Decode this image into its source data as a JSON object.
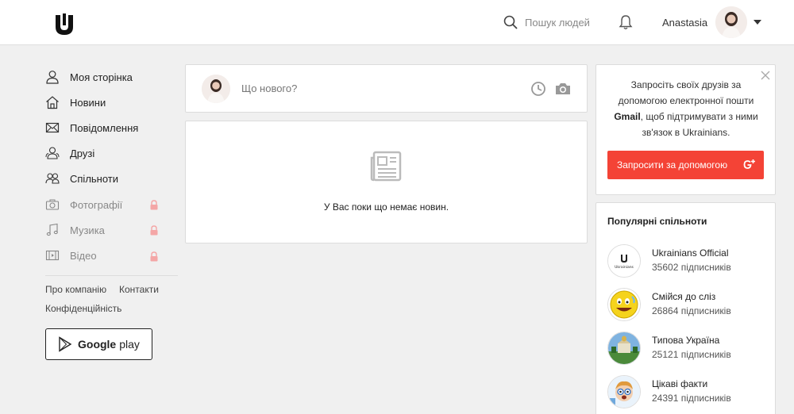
{
  "header": {
    "search_placeholder": "Пошук людей",
    "username": "Anastasia"
  },
  "sidebar": {
    "items": [
      {
        "label": "Моя сторінка",
        "icon": "user-icon",
        "locked": false
      },
      {
        "label": "Новини",
        "icon": "home-icon",
        "locked": false
      },
      {
        "label": "Повідомлення",
        "icon": "mail-icon",
        "locked": false
      },
      {
        "label": "Друзі",
        "icon": "friends-icon",
        "locked": false
      },
      {
        "label": "Спільноти",
        "icon": "communities-icon",
        "locked": false
      },
      {
        "label": "Фотографії",
        "icon": "camera-icon",
        "locked": true
      },
      {
        "label": "Музика",
        "icon": "music-icon",
        "locked": true
      },
      {
        "label": "Відео",
        "icon": "video-icon",
        "locked": true
      }
    ],
    "footer": {
      "about": "Про компанію",
      "contacts": "Контакти",
      "privacy": "Конфіденційність"
    },
    "gplay_brand": "Google",
    "gplay_word": "play"
  },
  "post": {
    "placeholder": "Що нового?"
  },
  "news": {
    "empty_text": "У Вас поки що немає новин."
  },
  "invite": {
    "text_1": "Запросіть своїх друзів за допомогою електронної пошти ",
    "text_bold": "Gmail",
    "text_2": ", щоб підтримувати з ними зв'язок в Ukrainians.",
    "button": "Запросити за допомогою",
    "button_color": "#f44336"
  },
  "communities": {
    "title": "Популярні спільноти",
    "items": [
      {
        "name": "Ukrainians Official",
        "count": "35602 підписників"
      },
      {
        "name": "Смійся до сліз",
        "count": "26864 підписників"
      },
      {
        "name": "Типова Україна",
        "count": "25121 підписників"
      },
      {
        "name": "Цікаві факти",
        "count": "24391 підписників"
      }
    ],
    "logo_text": "Ukrainians"
  }
}
